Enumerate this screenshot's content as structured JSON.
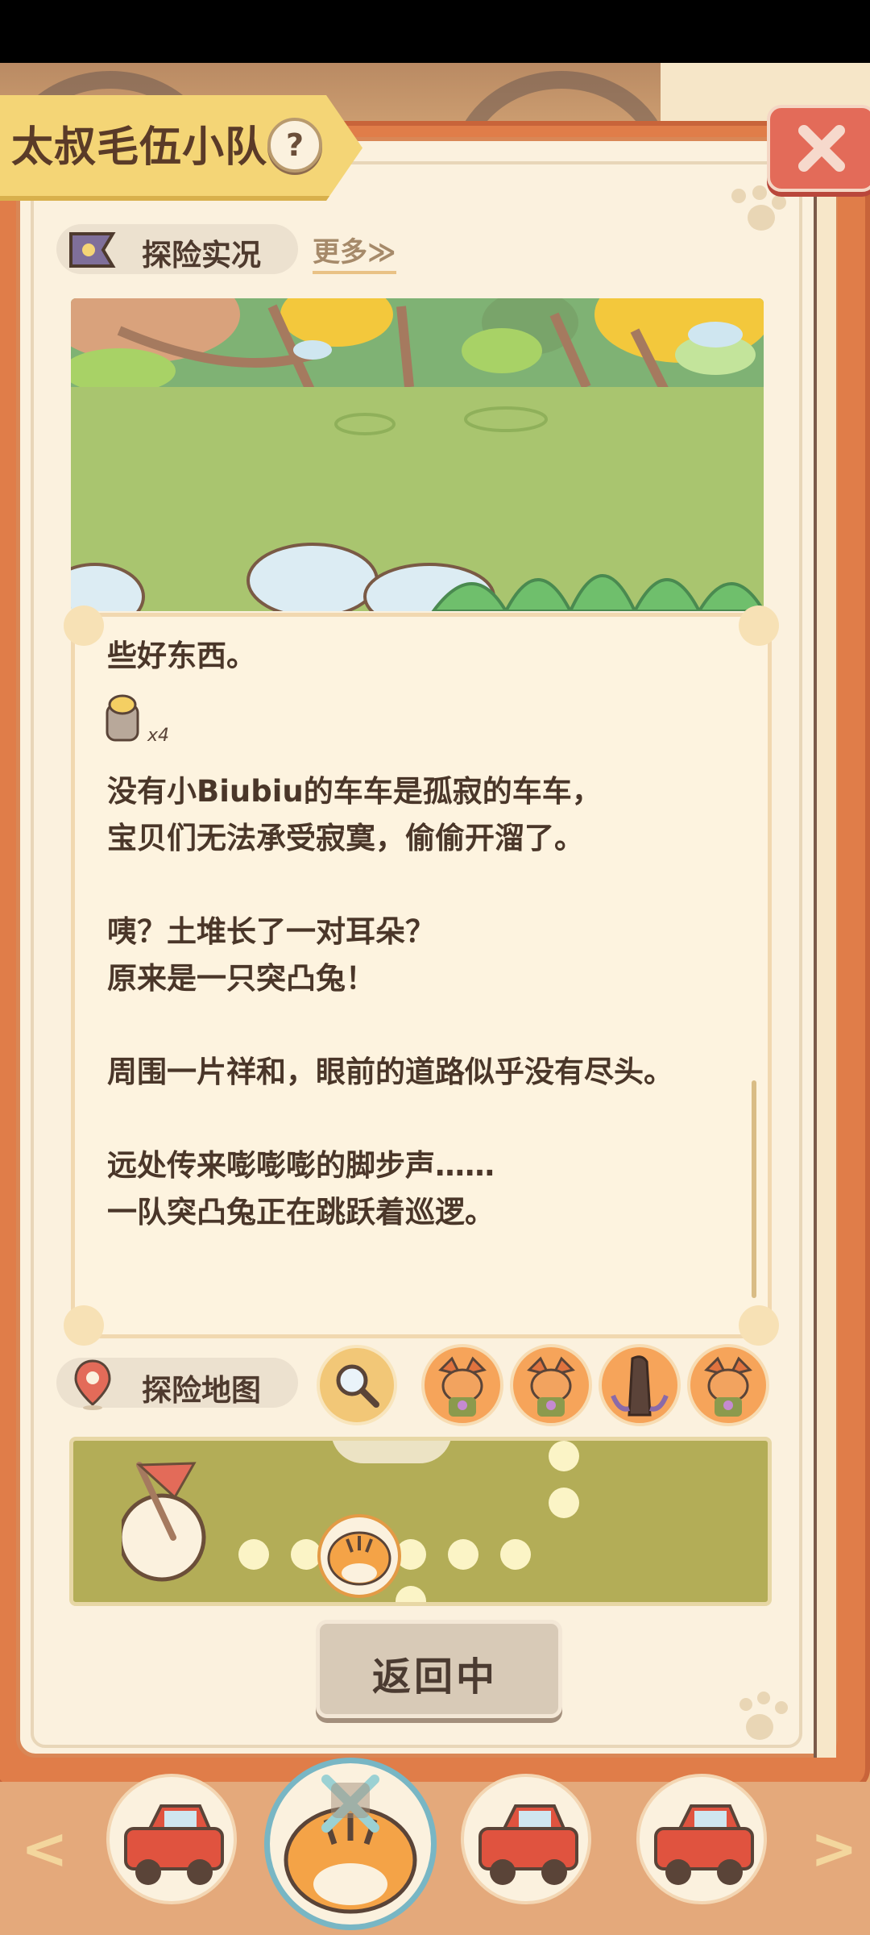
{
  "header": {
    "title": "太叔毛伍小队",
    "help_symbol": "?"
  },
  "live_section": {
    "label": "探险实况",
    "more_label": "更多≫"
  },
  "log": {
    "lines": [
      "些好东西。",
      "没有小Biubiu的车车是孤寂的车车，",
      "宝贝们无法承受寂寞，偷偷开溜了。",
      "咦？土堆长了一对耳朵？",
      "原来是一只突凸兔！",
      "周围一片祥和，眼前的道路似乎没有尽头。",
      "远处传来嘭嘭嘭的脚步声……",
      "一队突凸兔正在跳跃着巡逻。"
    ],
    "item_count": "x4"
  },
  "map_section": {
    "label": "探险地图"
  },
  "return_button": {
    "label": "返回中"
  },
  "nav": {
    "prev": "<",
    "next": ">"
  },
  "colors": {
    "accent_orange": "#e07d49",
    "page_cream": "#fbf1de",
    "banner_yellow": "#f4d576",
    "close_red": "#e36b59",
    "map_green": "#b3ad57"
  }
}
